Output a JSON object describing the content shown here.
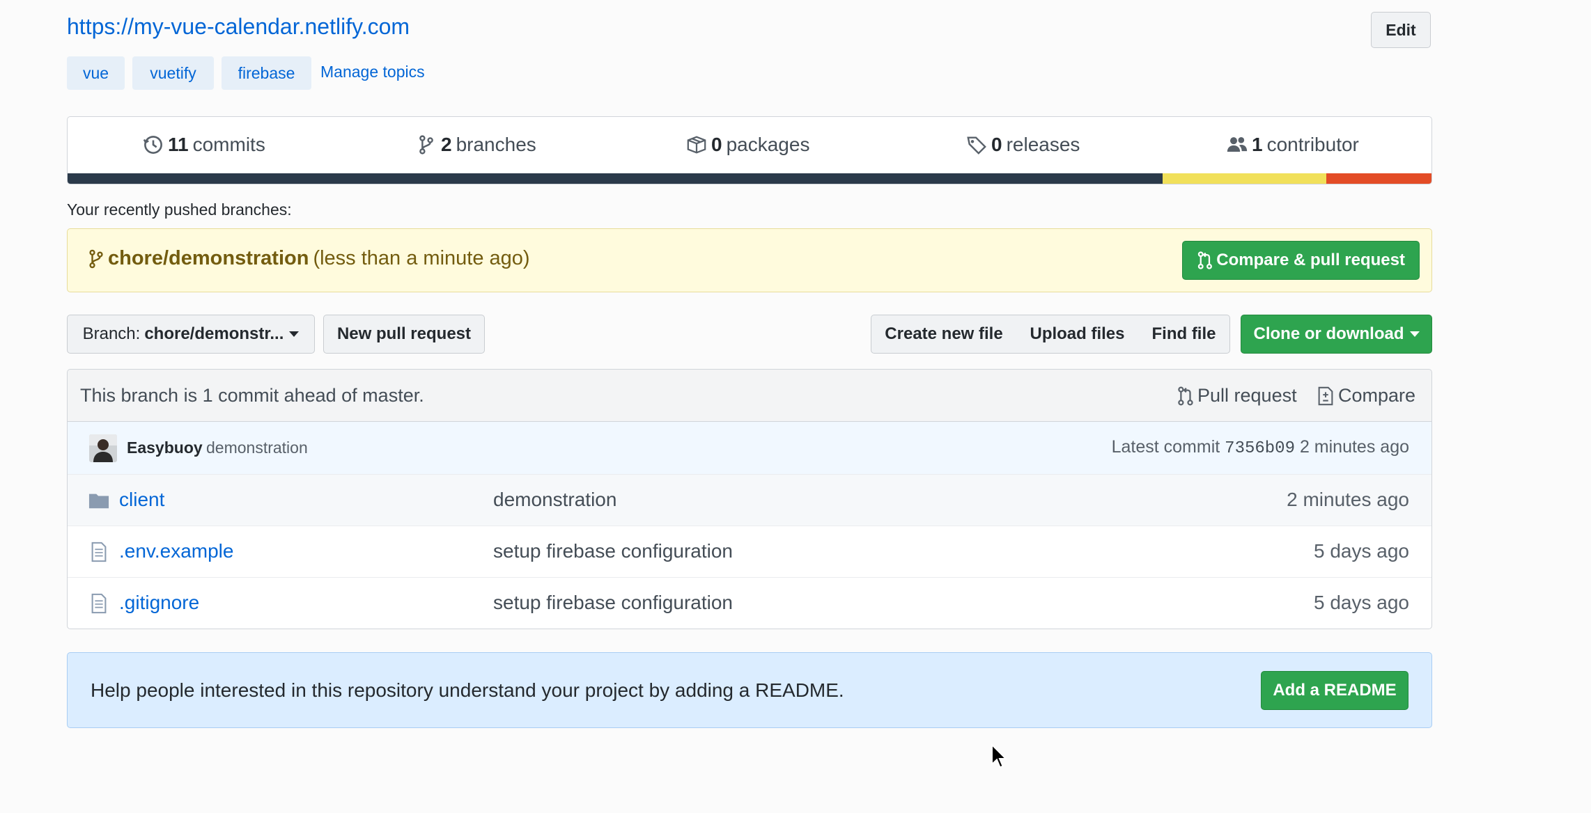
{
  "repo": {
    "homepage_url": "https://my-vue-calendar.netlify.com",
    "edit_label": "Edit",
    "topics": [
      "vue",
      "vuetify",
      "firebase"
    ],
    "manage_topics_label": "Manage topics"
  },
  "summary": {
    "commits": {
      "count": "11",
      "label": "commits"
    },
    "branches": {
      "count": "2",
      "label": "branches"
    },
    "packages": {
      "count": "0",
      "label": "packages"
    },
    "releases": {
      "count": "0",
      "label": "releases"
    },
    "contributors": {
      "count": "1",
      "label": "contributor"
    },
    "languages": [
      {
        "fraction": 0.803,
        "color": "#2b3a4a"
      },
      {
        "fraction": 0.12,
        "color": "#f1e05a"
      },
      {
        "fraction": 0.077,
        "color": "#e34c26"
      }
    ]
  },
  "recent": {
    "heading": "Your recently pushed branches:",
    "branch": "chore/demonstration",
    "time": "(less than a minute ago)",
    "button": "Compare & pull request"
  },
  "filenav": {
    "branch_prefix": "Branch:",
    "branch_name": "chore/demonstr...",
    "new_pr": "New pull request",
    "create_file": "Create new file",
    "upload_files": "Upload files",
    "find_file": "Find file",
    "clone": "Clone or download"
  },
  "branch_info": {
    "text": "This branch is 1 commit ahead of master.",
    "pull_request": "Pull request",
    "compare": "Compare"
  },
  "latest_commit": {
    "author": "Easybuoy",
    "message": "demonstration",
    "label": "Latest commit",
    "sha": "7356b09",
    "age": "2 minutes ago"
  },
  "files": [
    {
      "type": "folder",
      "icon": "folder-icon",
      "name": "client",
      "message": "demonstration",
      "age": "2 minutes ago"
    },
    {
      "type": "file",
      "icon": "file-icon",
      "name": ".env.example",
      "message": "setup firebase configuration",
      "age": "5 days ago"
    },
    {
      "type": "file",
      "icon": "file-icon",
      "name": ".gitignore",
      "message": "setup firebase configuration",
      "age": "5 days ago"
    }
  ],
  "readme": {
    "text": "Help people interested in this repository understand your project by adding a README.",
    "button": "Add a README"
  }
}
